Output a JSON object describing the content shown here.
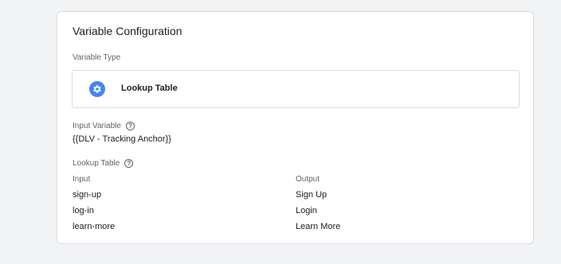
{
  "card": {
    "title": "Variable Configuration",
    "variable_type_label": "Variable Type",
    "variable_type": {
      "name": "Lookup Table",
      "icon": "gear-icon",
      "icon_color": "#4285f4"
    },
    "input_variable_label": "Input Variable",
    "input_variable_value": "{{DLV - Tracking Anchor}}",
    "lookup_table_label": "Lookup Table",
    "help_icon": "help-circle-icon"
  },
  "lookup_table": {
    "headers": {
      "input": "Input",
      "output": "Output"
    },
    "rows": [
      {
        "input": "sign-up",
        "output": "Sign Up"
      },
      {
        "input": "log-in",
        "output": "Login"
      },
      {
        "input": "learn-more",
        "output": "Learn More"
      }
    ]
  }
}
